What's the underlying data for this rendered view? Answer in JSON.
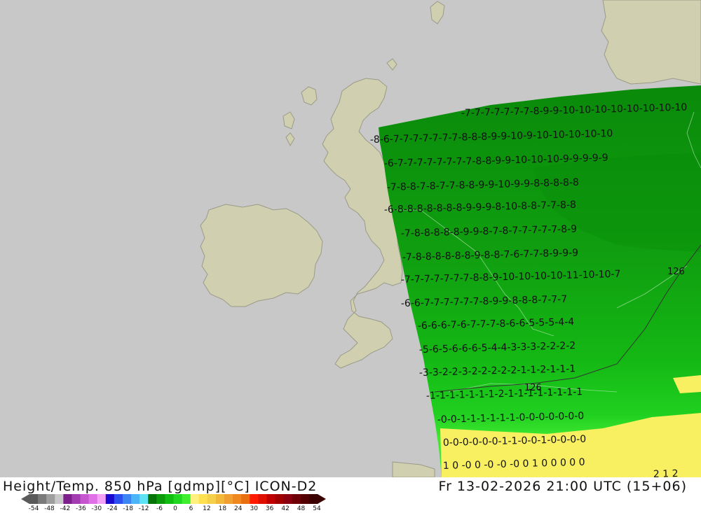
{
  "title": {
    "left": "Height/Temp. 850 hPa [gdmp][°C] ICON-D2",
    "right": "Fr 13-02-2026 21:00 UTC (15+06)"
  },
  "colors": {
    "sea": "#c8c8c8",
    "land": "#d0d0b0",
    "coast": "#9a9a88",
    "model_domain_edge": "#4e9a32"
  },
  "contour_labels": {
    "height": "126"
  },
  "temperature_rows": [
    "-7-7-7-7-7-7-7-8-9-9-10-10-10-10-10-10-10-10",
    "-8-6-7-7-7-7-7-7-7-8-8-8-9-9-10-9-10-10-10-10-10",
    "-6-7-7-7-7-7-7-7-7-8-8-9-9-10-10-10-9-9-9-9-9",
    "-7-8-8-7-8-7-7-8-8-9-9-10-9-9-8-8-8-8-8",
    "-6-8-8-8-8-8-8-8-9-9-9-8-10-8-8-7-7-8-8",
    "-7-8-8-8-8-8-9-9-8-7-8-7-7-7-7-7-8-9",
    "-7-8-8-8-8-8-8-9-8-8-7-6-7-7-8-9-9-9",
    "-7-7-7-7-7-7-7-8-8-9-10-10-10-10-11-10-10-7",
    "-6-6-7-7-7-7-7-7-8-9-9-8-8-8-7-7-7",
    "-6-6-6-7-6-7-7-7-8-6-6-5-5-5-4-4",
    "-5-6-5-6-6-6-5-4-4-3-3-3-2-2-2-2",
    "-3-3-2-2-3-2-2-2-2-2-1-1-2-1-1-1",
    "-1-1-1-1-1-1-1-2-1-1-1-1-1-1-1-1",
    "-0-0-1-1-1-1-1-1-0-0-0-0-0-0-0",
    "0-0-0-0-0-0-1-1-0-0-1-0-0-0-0",
    "1 0 -0 0 -0 -0 -0 0 1 0 0 0 0 0",
    "2 1 2"
  ],
  "legend": {
    "ticks": [
      "-54",
      "-48",
      "-42",
      "-36",
      "-30",
      "-24",
      "-18",
      "-12",
      "-6",
      "0",
      "6",
      "12",
      "18",
      "24",
      "30",
      "36",
      "42",
      "48",
      "54"
    ],
    "colors": [
      "#5a5a5a",
      "#7a7a7a",
      "#9e9e9e",
      "#c8c8c8",
      "#7d1f8c",
      "#a23cb0",
      "#c556d0",
      "#e070e6",
      "#f4a0f4",
      "#1a0ad0",
      "#2b50f0",
      "#3c85f5",
      "#4cb5f7",
      "#5ee3f5",
      "#067306",
      "#0a9a0a",
      "#10bd10",
      "#20d820",
      "#40ee30",
      "#fff080",
      "#ffe050",
      "#f5d04a",
      "#f2b83a",
      "#f0a030",
      "#f08820",
      "#e87010",
      "#ff1a00",
      "#e01000",
      "#c00000",
      "#a00000",
      "#8a0010",
      "#6e0008",
      "#520004",
      "#3a0000"
    ]
  }
}
